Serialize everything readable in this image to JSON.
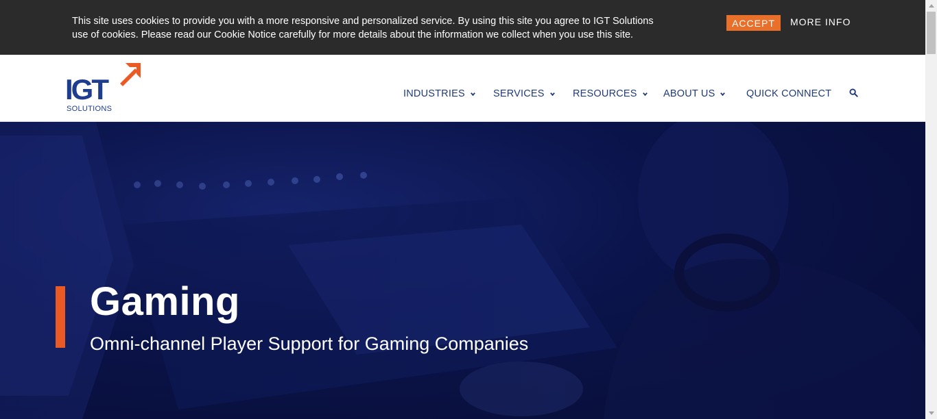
{
  "cookie_banner": {
    "text": "This site uses cookies to provide you with a more responsive and personalized service. By using this site you agree to IGT Solutions use of cookies. Please read our Cookie Notice carefully for more details about the information we collect when you use this site.",
    "accept_label": "ACCEPT",
    "more_info_label": "MORE INFO"
  },
  "header": {
    "logo": {
      "wordmark": "IGT",
      "subtitle": "SOLUTIONS"
    },
    "nav": [
      {
        "label": "INDUSTRIES",
        "has_dropdown": true
      },
      {
        "label": "SERVICES",
        "has_dropdown": true
      },
      {
        "label": "RESOURCES",
        "has_dropdown": true
      },
      {
        "label": "ABOUT US",
        "has_dropdown": true
      },
      {
        "label": "QUICK CONNECT",
        "has_dropdown": false
      }
    ],
    "search_icon": "search-icon"
  },
  "hero": {
    "title": "Gaming",
    "subtitle": "Omni-channel Player Support for Gaming Companies"
  },
  "colors": {
    "banner_bg": "#2b2b2b",
    "accent_orange": "#e8702a",
    "hero_bar": "#ea5a25",
    "nav_text": "#1f3a7a",
    "logo_blue": "#1f3d8f",
    "hero_bg": "#0c1650"
  }
}
